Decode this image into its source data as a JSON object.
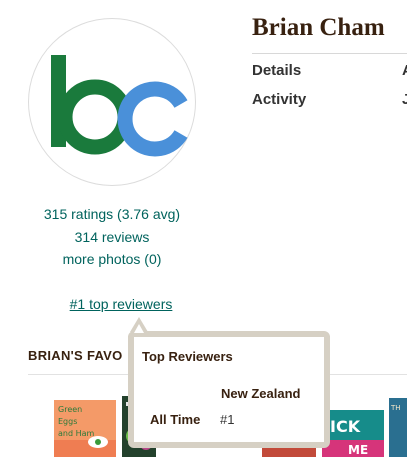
{
  "profile": {
    "name": "Brian Cham",
    "avatar_alt": "bc",
    "ratings": "315 ratings (3.76 avg)",
    "reviews": "314 reviews",
    "photos": "more photos (0)",
    "top_reviewers_link": "#1 top reviewers"
  },
  "info": {
    "details_label": "Details",
    "activity_label": "Activity",
    "details_cut": "A",
    "activity_cut": "J"
  },
  "favorites": {
    "heading": "BRIAN'S FAVO"
  },
  "popup": {
    "title": "Top Reviewers",
    "column": "New Zealand",
    "row_label": "All Time",
    "row_value": "#1"
  },
  "colors": {
    "link": "#00635d",
    "heading": "#382110",
    "logo_green": "#1a7a3c",
    "logo_blue": "#4a90d9"
  }
}
